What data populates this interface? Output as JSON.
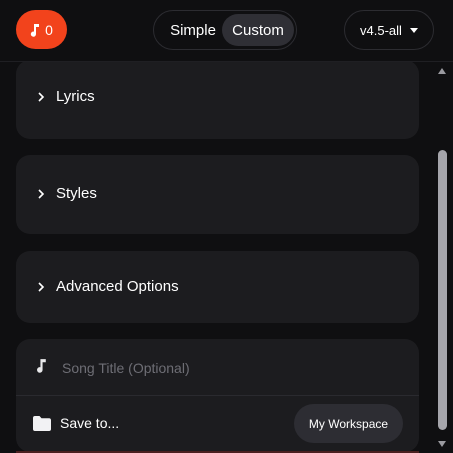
{
  "header": {
    "credits": {
      "icon": "music-note-icon",
      "count": "0"
    },
    "mode": {
      "simple_label": "Simple",
      "custom_label": "Custom",
      "selected": "Custom"
    },
    "version": {
      "label": "v4.5-all",
      "icon": "caret-down-icon"
    }
  },
  "sections": {
    "lyrics": {
      "label": "Lyrics",
      "icon": "chevron-right-icon"
    },
    "styles": {
      "label": "Styles",
      "icon": "chevron-right-icon"
    },
    "advanced": {
      "label": "Advanced Options",
      "icon": "chevron-right-icon"
    }
  },
  "song": {
    "title_placeholder": "Song Title (Optional)",
    "title_value": "",
    "note_icon": "music-note-icon",
    "save_label": "Save to...",
    "folder_icon": "folder-icon",
    "workspace_label": "My Workspace"
  },
  "colors": {
    "accent": "#f2431c",
    "background": "#0f0f11",
    "card": "#1c1c1f"
  }
}
